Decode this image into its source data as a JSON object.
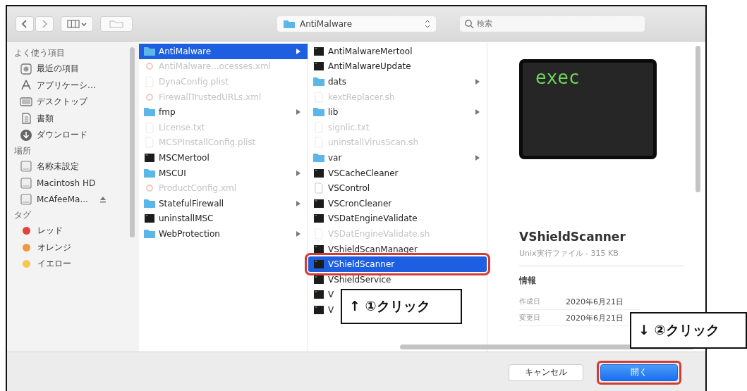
{
  "toolbar": {
    "path": "AntiMalware",
    "search": {
      "placeholder": "検索"
    }
  },
  "sidebar": [
    {
      "title": "よく使う項目",
      "items": [
        {
          "label": "最近の項目",
          "kind": "recent"
        },
        {
          "label": "アプリケーシ…",
          "kind": "apps"
        },
        {
          "label": "デスクトップ",
          "kind": "desktop"
        },
        {
          "label": "書類",
          "kind": "docs"
        },
        {
          "label": "ダウンロード",
          "kind": "download"
        }
      ]
    },
    {
      "title": "場所",
      "items": [
        {
          "label": "名称未設定",
          "kind": "disk",
          "eject": false
        },
        {
          "label": "Macintosh HD",
          "kind": "disk",
          "eject": false
        },
        {
          "label": "McAfeeMa...",
          "kind": "disk",
          "eject": true
        }
      ]
    },
    {
      "title": "タグ",
      "items": [
        {
          "label": "レッド",
          "kind": "tag",
          "color": "#e0443a"
        },
        {
          "label": "オレンジ",
          "kind": "tag",
          "color": "#f0983a"
        },
        {
          "label": "イエロー",
          "kind": "tag",
          "color": "#f2c94c"
        }
      ]
    }
  ],
  "columns": [
    [
      {
        "name": "AntiMalware",
        "kind": "folder",
        "arrow": true,
        "disabled": false,
        "selected": true,
        "annotated": false
      },
      {
        "name": "AntiMalware...ocesses.xml",
        "kind": "xml",
        "arrow": false,
        "disabled": true,
        "selected": false,
        "annotated": false
      },
      {
        "name": "DynaConfig.plist",
        "kind": "doc",
        "arrow": false,
        "disabled": true,
        "selected": false,
        "annotated": false
      },
      {
        "name": "FirewallTrustedURLs.xml",
        "kind": "xml",
        "arrow": false,
        "disabled": true,
        "selected": false,
        "annotated": false
      },
      {
        "name": "fmp",
        "kind": "folder",
        "arrow": true,
        "disabled": false,
        "selected": false,
        "annotated": false
      },
      {
        "name": "License.txt",
        "kind": "doc",
        "arrow": false,
        "disabled": true,
        "selected": false,
        "annotated": false
      },
      {
        "name": "MCSPInstallConfig.plist",
        "kind": "doc",
        "arrow": false,
        "disabled": true,
        "selected": false,
        "annotated": false
      },
      {
        "name": "MSCMertool",
        "kind": "exec",
        "arrow": false,
        "disabled": false,
        "selected": false,
        "annotated": false
      },
      {
        "name": "MSCUI",
        "kind": "folder",
        "arrow": true,
        "disabled": false,
        "selected": false,
        "annotated": false
      },
      {
        "name": "ProductConfig.xml",
        "kind": "xml",
        "arrow": false,
        "disabled": true,
        "selected": false,
        "annotated": false
      },
      {
        "name": "StatefulFirewall",
        "kind": "folder",
        "arrow": true,
        "disabled": false,
        "selected": false,
        "annotated": false
      },
      {
        "name": "uninstallMSC",
        "kind": "exec",
        "arrow": false,
        "disabled": false,
        "selected": false,
        "annotated": false
      },
      {
        "name": "WebProtection",
        "kind": "folder",
        "arrow": true,
        "disabled": false,
        "selected": false,
        "annotated": false
      }
    ],
    [
      {
        "name": "AntiMalwareMertool",
        "kind": "exec",
        "arrow": false,
        "disabled": false,
        "selected": false,
        "annotated": false
      },
      {
        "name": "AntiMalwareUpdate",
        "kind": "exec",
        "arrow": false,
        "disabled": false,
        "selected": false,
        "annotated": false
      },
      {
        "name": "dats",
        "kind": "folder",
        "arrow": true,
        "disabled": false,
        "selected": false,
        "annotated": false
      },
      {
        "name": "kextReplacer.sh",
        "kind": "doc",
        "arrow": false,
        "disabled": true,
        "selected": false,
        "annotated": false
      },
      {
        "name": "lib",
        "kind": "folder",
        "arrow": true,
        "disabled": false,
        "selected": false,
        "annotated": false
      },
      {
        "name": "signlic.txt",
        "kind": "doc",
        "arrow": false,
        "disabled": true,
        "selected": false,
        "annotated": false
      },
      {
        "name": "uninstallVirusScan.sh",
        "kind": "doc",
        "arrow": false,
        "disabled": true,
        "selected": false,
        "annotated": false
      },
      {
        "name": "var",
        "kind": "folder",
        "arrow": true,
        "disabled": false,
        "selected": false,
        "annotated": false
      },
      {
        "name": "VSCacheCleaner",
        "kind": "exec",
        "arrow": false,
        "disabled": false,
        "selected": false,
        "annotated": false
      },
      {
        "name": "VSControl",
        "kind": "doc",
        "arrow": false,
        "disabled": false,
        "selected": false,
        "annotated": false
      },
      {
        "name": "VSCronCleaner",
        "kind": "exec",
        "arrow": false,
        "disabled": false,
        "selected": false,
        "annotated": false
      },
      {
        "name": "VSDatEngineValidate",
        "kind": "exec",
        "arrow": false,
        "disabled": false,
        "selected": false,
        "annotated": false
      },
      {
        "name": "VSDatEngineValidate.sh",
        "kind": "doc",
        "arrow": false,
        "disabled": true,
        "selected": false,
        "annotated": false
      },
      {
        "name": "VShieldScanManager",
        "kind": "exec",
        "arrow": false,
        "disabled": false,
        "selected": false,
        "annotated": false
      },
      {
        "name": "VShieldScanner",
        "kind": "exec",
        "arrow": false,
        "disabled": false,
        "selected": true,
        "annotated": true
      },
      {
        "name": "VShieldService",
        "kind": "exec",
        "arrow": false,
        "disabled": false,
        "selected": false,
        "annotated": false
      },
      {
        "name": "V",
        "kind": "exec",
        "arrow": false,
        "disabled": false,
        "selected": false,
        "annotated": false
      },
      {
        "name": "V",
        "kind": "exec",
        "arrow": false,
        "disabled": false,
        "selected": false,
        "annotated": false
      }
    ]
  ],
  "preview": {
    "icon_text": "exec",
    "name": "VShieldScanner",
    "subtitle": "Unix実行ファイル - 315 KB",
    "info_title": "情報",
    "info": [
      {
        "label": "作成日",
        "value": "2020年6月21日"
      },
      {
        "label": "変更日",
        "value": "2020年6月21日"
      }
    ]
  },
  "buttons": [
    {
      "label": "キャンセル",
      "default": false,
      "annotated": false
    },
    {
      "label": "開く",
      "default": true,
      "annotated": true
    }
  ],
  "callouts": [
    {
      "text": "↑ ①クリック"
    },
    {
      "text": "↓ ②クリック"
    }
  ]
}
